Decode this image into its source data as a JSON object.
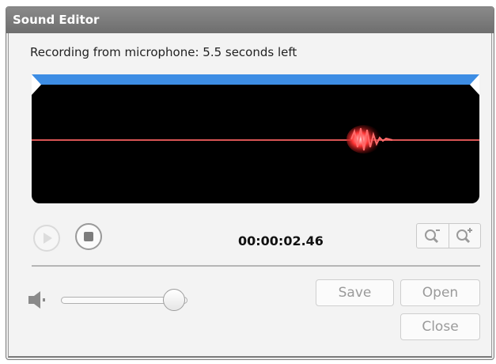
{
  "window": {
    "title": "Sound Editor"
  },
  "status": {
    "text": "Recording from microphone: 5.5 seconds left"
  },
  "playback": {
    "time": "00:00:02.46"
  },
  "buttons": {
    "save": "Save",
    "open": "Open",
    "close": "Close"
  },
  "icons": {
    "play": "play-icon",
    "stop": "stop-icon",
    "zoom_out": "zoom-out-icon",
    "zoom_in": "zoom-in-icon",
    "speaker": "speaker-icon"
  },
  "colors": {
    "accent": "#3d8de4",
    "waveform": "#d95555"
  }
}
